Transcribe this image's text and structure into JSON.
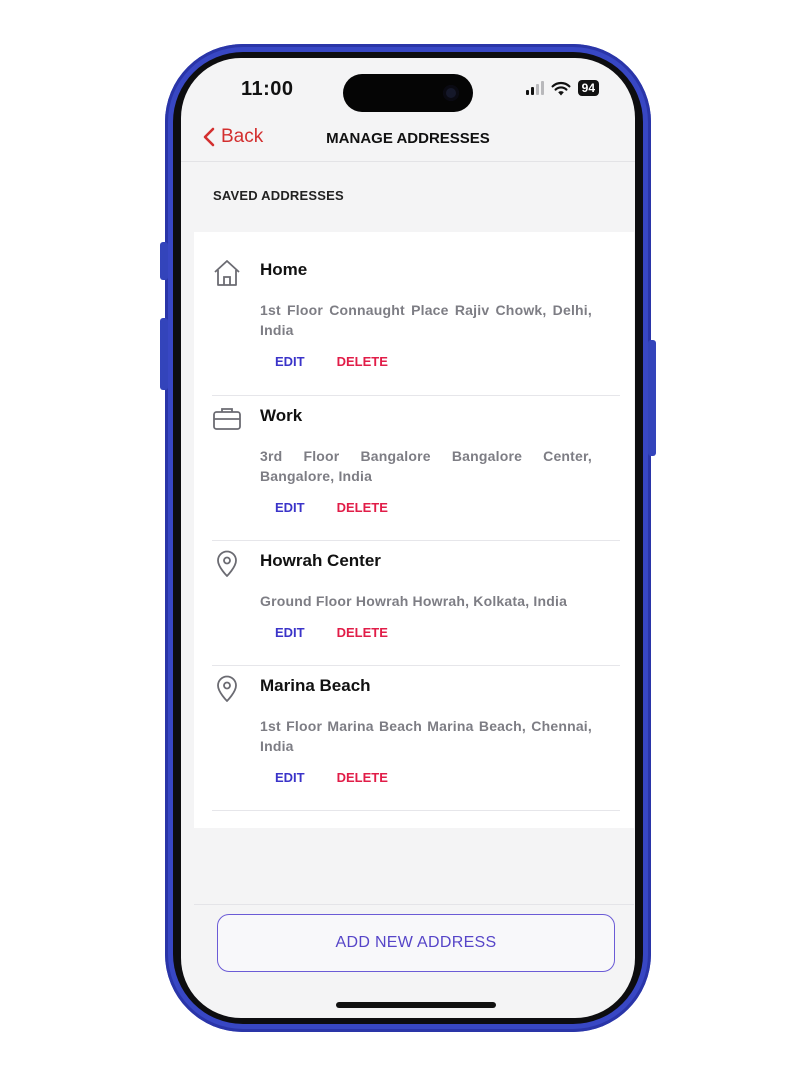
{
  "status": {
    "time": "11:00",
    "battery": "94"
  },
  "nav": {
    "back_label": "Back",
    "title": "MANAGE ADDRESSES"
  },
  "section_label": "SAVED ADDRESSES",
  "addresses": [
    {
      "icon": "home-icon",
      "title": "Home",
      "address": "1st Floor Connaught Place Rajiv Chowk, Delhi, India",
      "edit": "EDIT",
      "delete": "DELETE"
    },
    {
      "icon": "briefcase-icon",
      "title": "Work",
      "address": "3rd Floor Bangalore Bangalore Center, Bangalore, India",
      "edit": "EDIT",
      "delete": "DELETE"
    },
    {
      "icon": "location-pin-icon",
      "title": "Howrah Center",
      "address": "Ground Floor Howrah Howrah, Kolkata, India",
      "edit": "EDIT",
      "delete": "DELETE"
    },
    {
      "icon": "location-pin-icon",
      "title": "Marina Beach",
      "address": "1st Floor Marina Beach Marina Beach, Chennai, India",
      "edit": "EDIT",
      "delete": "DELETE"
    }
  ],
  "add_button_label": "ADD NEW ADDRESS",
  "colors": {
    "frame": "#3847c4",
    "back": "#d32f2f",
    "edit": "#3b34c9",
    "delete": "#e11d48",
    "add_button": "#5645c8"
  }
}
